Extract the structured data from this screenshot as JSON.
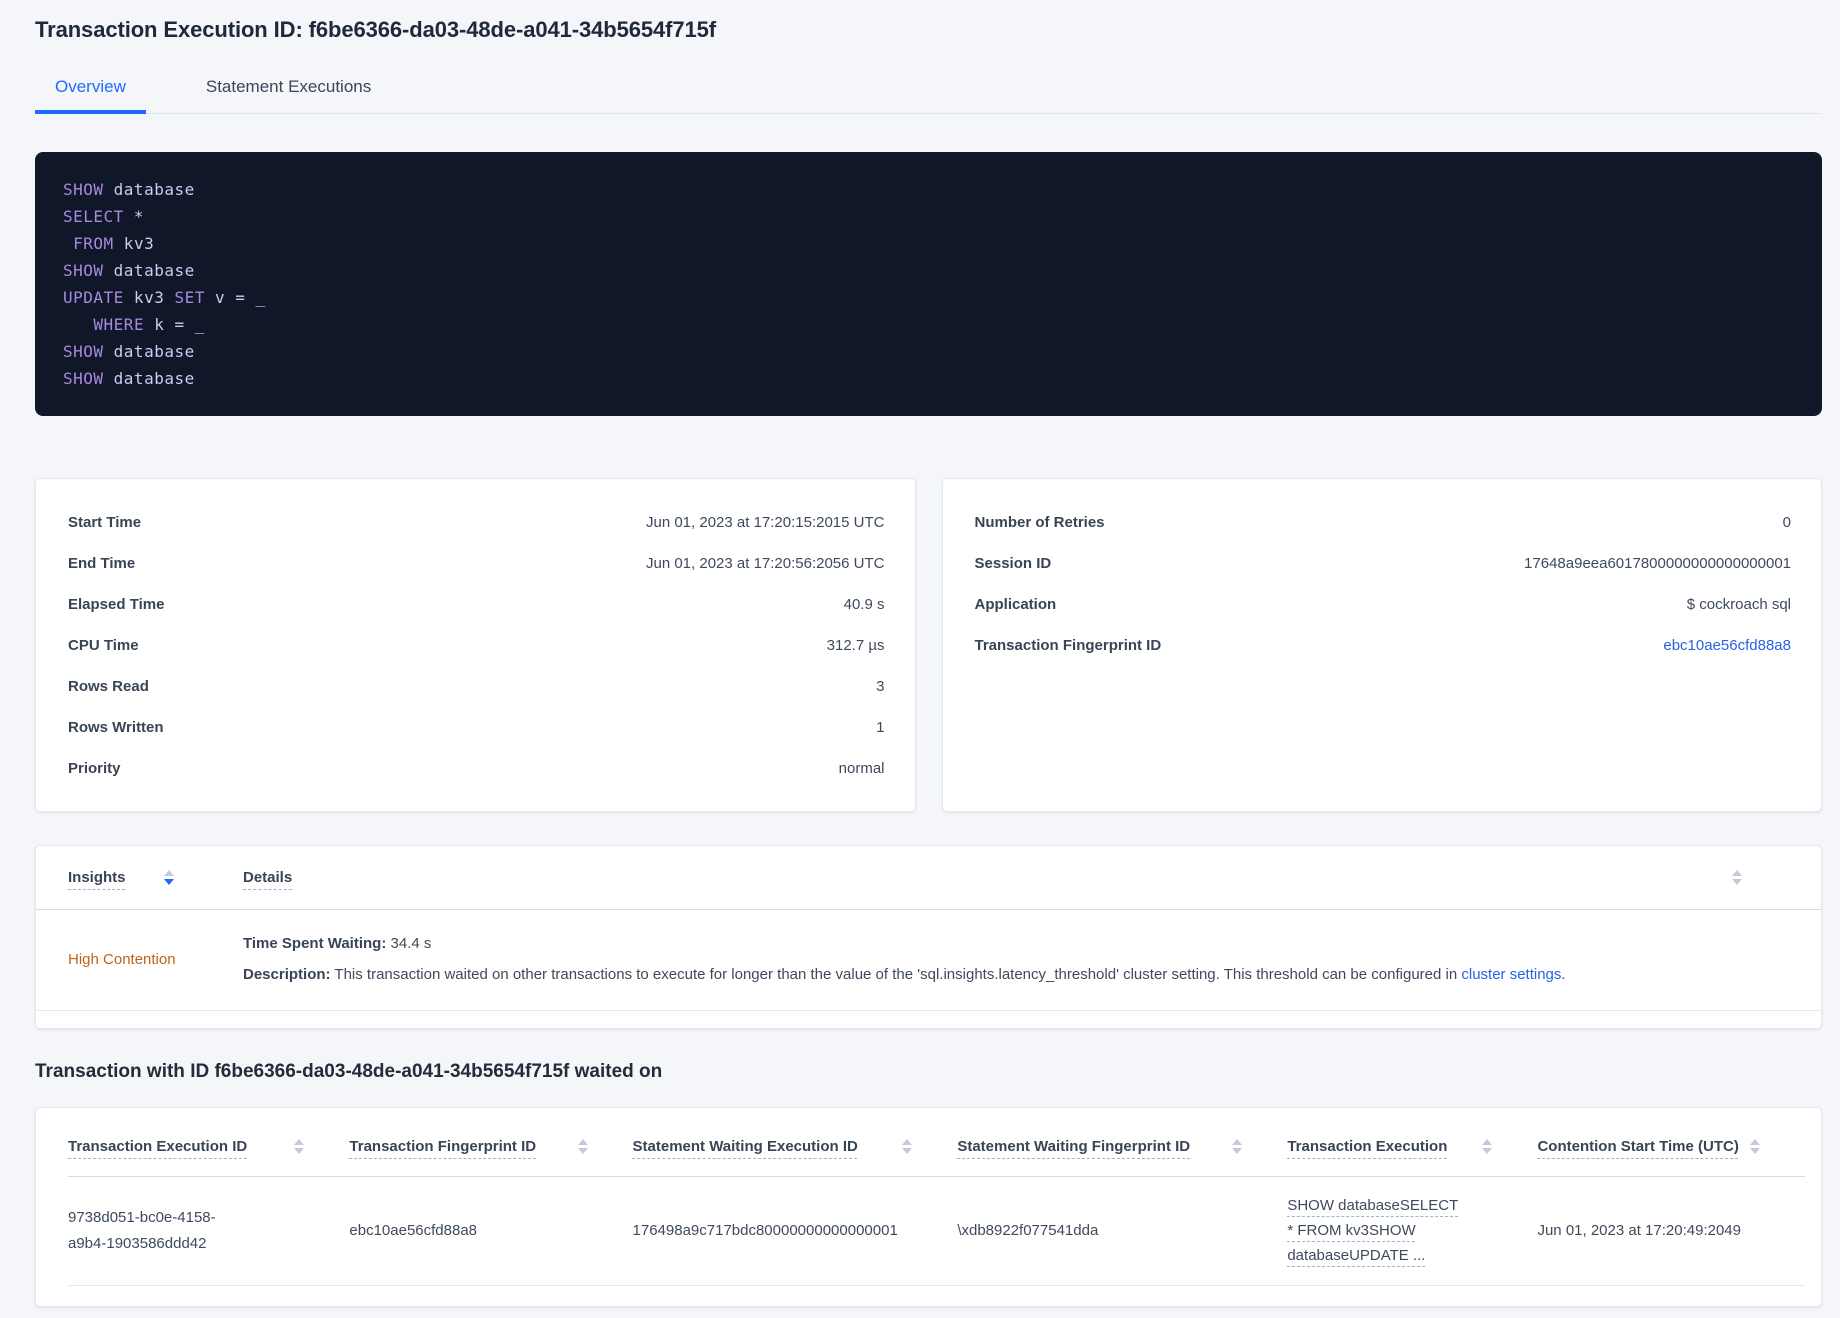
{
  "header": {
    "title": "Transaction Execution ID: f6be6366-da03-48de-a041-34b5654f715f"
  },
  "tabs": [
    {
      "label": "Overview",
      "active": true
    },
    {
      "label": "Statement Executions",
      "active": false
    }
  ],
  "sql": {
    "lines": [
      [
        [
          "k",
          "SHOW"
        ],
        [
          "i",
          " database"
        ]
      ],
      [
        [
          "k",
          "SELECT"
        ],
        [
          "i",
          " *"
        ]
      ],
      [
        [
          "i",
          " "
        ],
        [
          "k",
          "FROM"
        ],
        [
          "i",
          " kv3"
        ]
      ],
      [
        [
          "k",
          "SHOW"
        ],
        [
          "i",
          " database"
        ]
      ],
      [
        [
          "k",
          "UPDATE"
        ],
        [
          "i",
          " kv3 "
        ],
        [
          "k",
          "SET"
        ],
        [
          "i",
          " v = _"
        ]
      ],
      [
        [
          "i",
          "   "
        ],
        [
          "k",
          "WHERE"
        ],
        [
          "i",
          " k = _"
        ]
      ],
      [
        [
          "k",
          "SHOW"
        ],
        [
          "i",
          " database"
        ]
      ],
      [
        [
          "k",
          "SHOW"
        ],
        [
          "i",
          " database"
        ]
      ]
    ]
  },
  "execution_card": {
    "rows": [
      {
        "label": "Start Time",
        "value": "Jun 01, 2023 at 17:20:15:2015 UTC"
      },
      {
        "label": "End Time",
        "value": "Jun 01, 2023 at 17:20:56:2056 UTC"
      },
      {
        "label": "Elapsed Time",
        "value": "40.9 s"
      },
      {
        "label": "CPU Time",
        "value": "312.7 µs"
      },
      {
        "label": "Rows Read",
        "value": "3"
      },
      {
        "label": "Rows Written",
        "value": "1"
      },
      {
        "label": "Priority",
        "value": "normal"
      }
    ]
  },
  "session_card": {
    "rows": [
      {
        "label": "Number of Retries",
        "value": "0"
      },
      {
        "label": "Session ID",
        "value": "17648a9eea6017800000000000000001"
      },
      {
        "label": "Application",
        "value": "$ cockroach sql"
      },
      {
        "label": "Transaction Fingerprint ID",
        "value": "ebc10ae56cfd88a8",
        "link": true
      }
    ]
  },
  "insights_table": {
    "columns": [
      {
        "label": "Insights",
        "sort": "desc"
      },
      {
        "label": "Details",
        "sort": null
      }
    ],
    "row": {
      "insight": "High Contention",
      "waiting_label": "Time Spent Waiting:",
      "waiting_value": " 34.4 s",
      "description_label": "Description:",
      "description_text": " This transaction waited on other transactions to execute for longer than the value of the 'sql.insights.latency_threshold' cluster setting. This threshold can be configured in ",
      "description_link": "cluster settings",
      "description_suffix": "."
    }
  },
  "waited_on": {
    "title": "Transaction with ID f6be6366-da03-48de-a041-34b5654f715f waited on",
    "columns": [
      "Transaction Execution ID",
      "Transaction Fingerprint ID",
      "Statement Waiting Execution ID",
      "Statement Waiting Fingerprint ID",
      "Transaction Execution",
      "Contention Start Time (UTC)"
    ],
    "rows": [
      {
        "transaction_execution_id": "9738d051-bc0e-4158-a9b4-1903586ddd42",
        "transaction_fingerprint_id": "ebc10ae56cfd88a8",
        "statement_waiting_execution_id": "176498a9c717bdc80000000000000001",
        "statement_waiting_fingerprint_id": "\\xdb8922f077541dda",
        "transaction_execution": "SHOW databaseSELECT * FROM kv3SHOW databaseUPDATE ...",
        "contention_start_time": "Jun 01, 2023 at 17:20:49:2049"
      }
    ]
  },
  "colors": {
    "accent_blue": "#1f69ff",
    "link_blue": "#2962e4",
    "insight_orange": "#c26418",
    "code_background": "#0f1729",
    "code_keyword": "#a988dd",
    "code_identifier": "#d0c9f1"
  }
}
